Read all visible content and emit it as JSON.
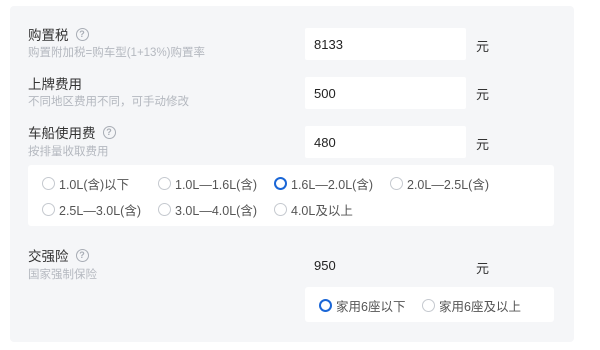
{
  "purchase_tax": {
    "label": "购置税",
    "help_icon": "question-circle-icon",
    "note": "购置附加税=购车型(1+13%)购置率",
    "value": "8133",
    "unit": "元"
  },
  "license_fee": {
    "label": "上牌费用",
    "note": "不同地区费用不同，可手动修改",
    "value": "500",
    "unit": "元"
  },
  "vessel_tax": {
    "label": "车船使用费",
    "help_icon": "question-circle-icon",
    "note": "按排量收取费用",
    "value": "480",
    "unit": "元",
    "options": [
      {
        "label": "1.0L(含)以下",
        "selected": false
      },
      {
        "label": "1.0L—1.6L(含)",
        "selected": false
      },
      {
        "label": "1.6L—2.0L(含)",
        "selected": true
      },
      {
        "label": "2.0L—2.5L(含)",
        "selected": false
      },
      {
        "label": "2.5L—3.0L(含)",
        "selected": false
      },
      {
        "label": "3.0L—4.0L(含)",
        "selected": false
      },
      {
        "label": "4.0L及以上",
        "selected": false
      }
    ]
  },
  "compulsory_insurance": {
    "label": "交强险",
    "help_icon": "question-circle-icon",
    "note": "国家强制保险",
    "value": "950",
    "unit": "元",
    "options": [
      {
        "label": "家用6座以下",
        "selected": true
      },
      {
        "label": "家用6座及以上",
        "selected": false
      }
    ]
  },
  "colors": {
    "panel_bg": "#f5f6f8",
    "accent": "#1a66d6",
    "muted_text": "#b4b8bf"
  }
}
